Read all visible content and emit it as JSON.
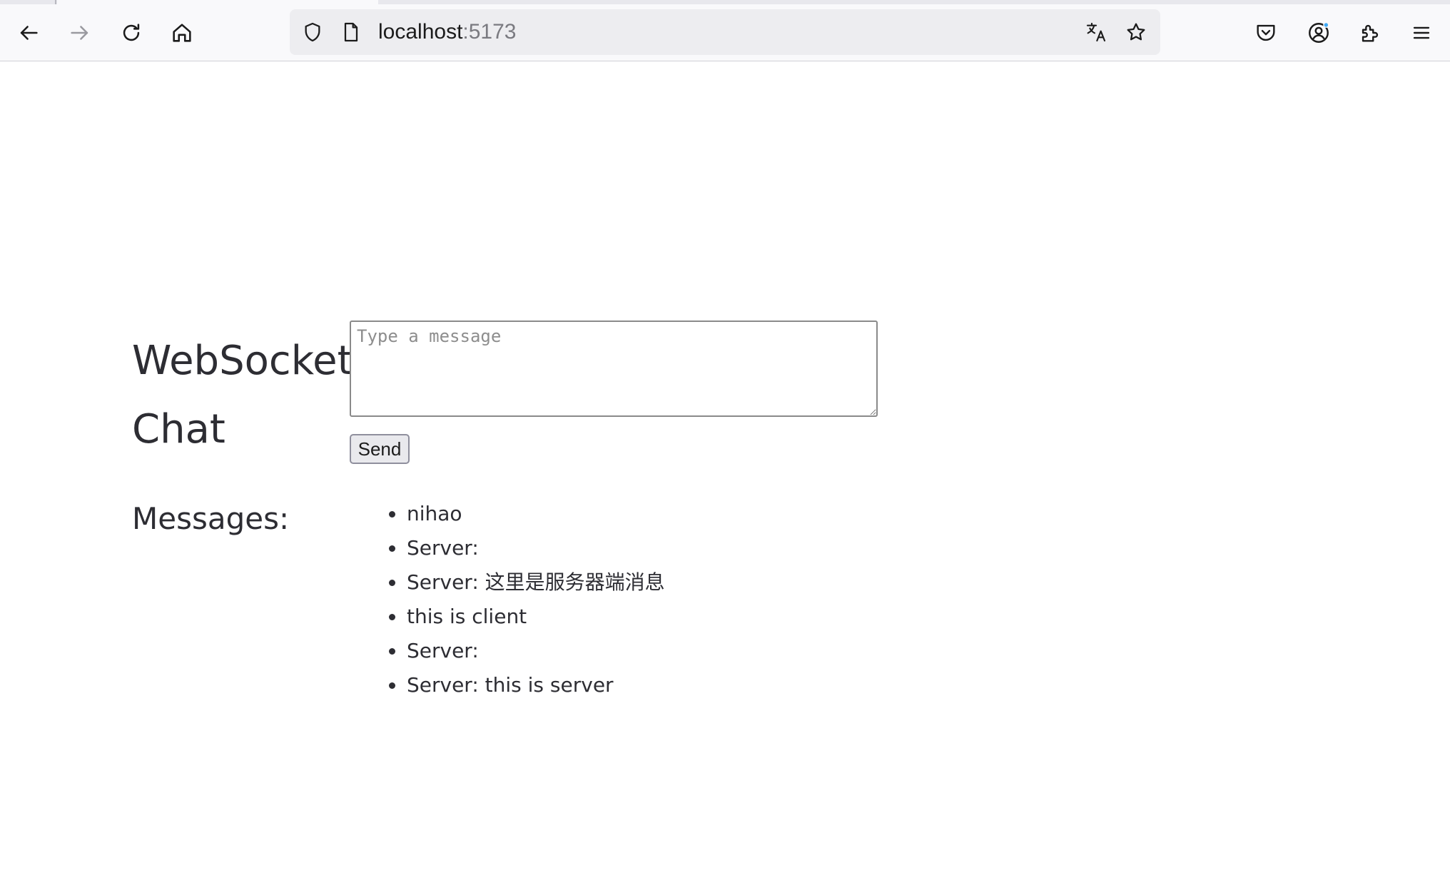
{
  "browser": {
    "url_host": "localhost",
    "url_port": ":5173",
    "icons": {
      "back": "arrow-left-icon",
      "forward": "arrow-right-icon",
      "reload": "reload-icon",
      "home": "home-icon",
      "shield": "shield-icon",
      "page": "page-icon",
      "translate": "translate-icon",
      "bookmark": "star-icon",
      "pocket": "pocket-icon",
      "account": "account-icon",
      "extensions": "extensions-icon",
      "menu": "hamburger-menu-icon"
    }
  },
  "page": {
    "title": "WebSocket Chat",
    "input_placeholder": "Type a message",
    "input_value": "",
    "send_label": "Send",
    "messages_heading": "Messages:",
    "messages": [
      "nihao",
      "Server:",
      "Server: 这里是服务器端消息",
      "this is client",
      "Server:",
      "Server: this is server"
    ]
  },
  "colors": {
    "toolbar_bg": "#f9f9fb",
    "urlbar_bg": "#ededf0",
    "text": "#2d2d33",
    "notification_dot": "#3fa9f5"
  }
}
